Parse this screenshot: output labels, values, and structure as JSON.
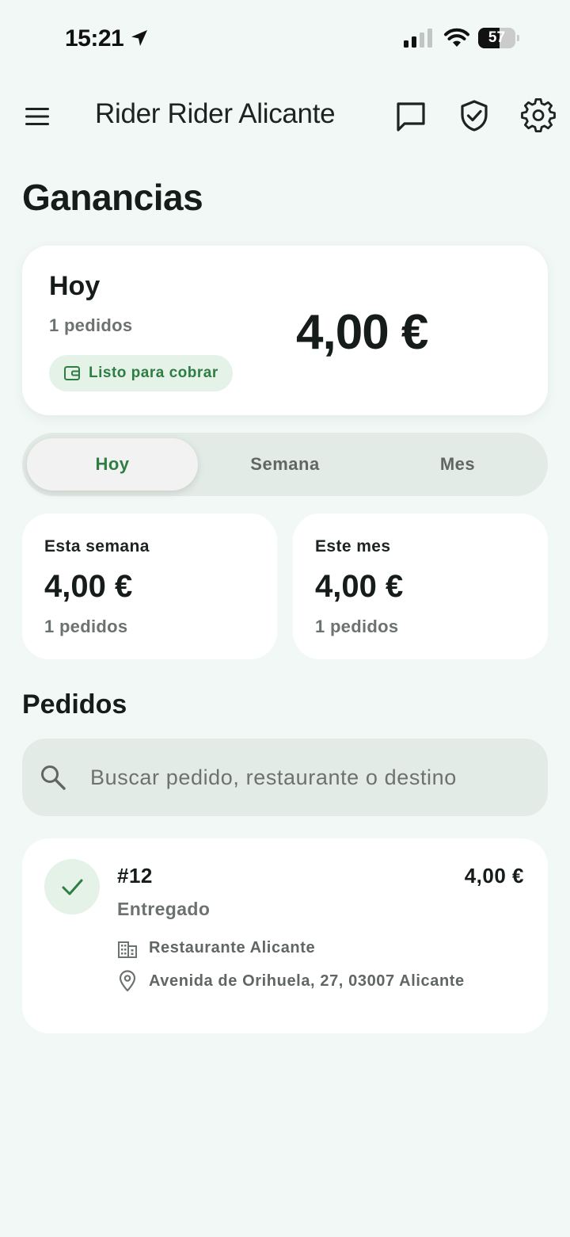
{
  "status_bar": {
    "time": "15:21",
    "battery": "57",
    "battery_level": 0.57
  },
  "app_bar": {
    "title": "Rider Rider Alicante",
    "icons": [
      "menu-icon",
      "chat-icon",
      "shield-check-icon",
      "gear-icon"
    ]
  },
  "page": {
    "title": "Ganancias"
  },
  "hero": {
    "period": "Hoy",
    "orders": "1 pedidos",
    "badge": "Listo para cobrar",
    "amount": "4,00 €"
  },
  "tabs": [
    {
      "label": "Hoy",
      "active": true
    },
    {
      "label": "Semana",
      "active": false
    },
    {
      "label": "Mes",
      "active": false
    }
  ],
  "summary": [
    {
      "label": "Esta semana",
      "amount": "4,00 €",
      "orders": "1 pedidos"
    },
    {
      "label": "Este mes",
      "amount": "4,00 €",
      "orders": "1 pedidos"
    }
  ],
  "orders_section": {
    "title": "Pedidos",
    "search_placeholder": "Buscar pedido, restaurante o destino"
  },
  "orders": [
    {
      "id": "#12",
      "status": "Entregado",
      "amount": "4,00 €",
      "restaurant": "Restaurante Alicante",
      "address": "Avenida de Orihuela, 27, 03007 Alicante"
    }
  ],
  "colors": {
    "background": "#f2f8f5",
    "accent": "#2e7d43",
    "badge_bg": "#e5f2e8",
    "muted": "#6b726f"
  }
}
